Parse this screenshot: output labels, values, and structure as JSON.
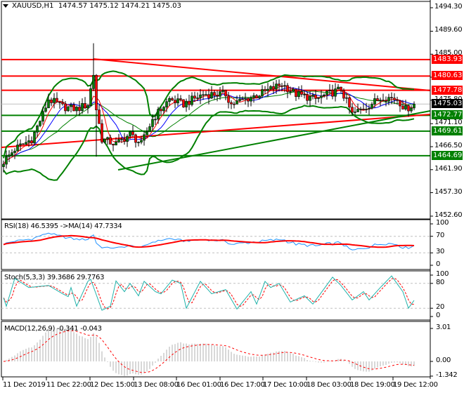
{
  "header": {
    "symbol": "XAUUSD,H1",
    "open": "1474.57",
    "high": "1475.12",
    "low": "1474.21",
    "close": "1475.03"
  },
  "price_axis": [
    "1494.30",
    "1489.60",
    "1485.00",
    "1480.40",
    "1475.80",
    "1471.10",
    "1466.50",
    "1461.90",
    "1457.30",
    "1452.60"
  ],
  "levels": [
    {
      "value": "1483.93",
      "color": "#ff0000"
    },
    {
      "value": "1480.63",
      "color": "#ff0000"
    },
    {
      "value": "1477.78",
      "color": "#ff0000"
    },
    {
      "value": "1475.03",
      "color": "#000000"
    },
    {
      "value": "1472.77",
      "color": "#008000"
    },
    {
      "value": "1469.61",
      "color": "#008000"
    },
    {
      "value": "1464.69",
      "color": "#008000"
    }
  ],
  "rsi": {
    "label": "RSI(18) 46.5395  ->MA(14) 47.7334",
    "axis": [
      "100",
      "70",
      "30",
      "0"
    ]
  },
  "stoch": {
    "label": "Stoch(5,3,3) 39.3686 29.7763",
    "axis": [
      "100",
      "80",
      "20",
      "0"
    ]
  },
  "macd": {
    "label": "MACD(12,26,9) -0.341 -0.043",
    "axis": [
      "3.01",
      "0.00",
      "-1.342"
    ]
  },
  "time_axis": [
    "11 Dec 2019",
    "11 Dec 22:00",
    "12 Dec 15:00",
    "13 Dec 08:00",
    "16 Dec 01:00",
    "16 Dec 17:00",
    "17 Dec 10:00",
    "18 Dec 03:00",
    "18 Dec 19:00",
    "19 Dec 12:00"
  ],
  "chart_data": {
    "type": "candlestick",
    "price_range": [
      1452.6,
      1494.3
    ],
    "close_keypoints": [
      [
        0,
        1463.5
      ],
      [
        4,
        1466
      ],
      [
        10,
        1468
      ],
      [
        14,
        1473
      ],
      [
        16,
        1476
      ],
      [
        21,
        1474.5
      ],
      [
        26,
        1474
      ],
      [
        30,
        1475
      ],
      [
        32,
        1481
      ],
      [
        33,
        1474
      ],
      [
        35,
        1468
      ],
      [
        40,
        1467
      ],
      [
        45,
        1469
      ],
      [
        49,
        1467
      ],
      [
        53,
        1472
      ],
      [
        59,
        1476
      ],
      [
        64,
        1475
      ],
      [
        71,
        1477
      ],
      [
        79,
        1477
      ],
      [
        81,
        1475
      ],
      [
        91,
        1477
      ],
      [
        99,
        1479
      ],
      [
        104,
        1477
      ],
      [
        111,
        1476
      ],
      [
        120,
        1478
      ],
      [
        124,
        1473
      ],
      [
        129,
        1474.5
      ],
      [
        135,
        1476.5
      ],
      [
        140,
        1476
      ],
      [
        143,
        1474
      ],
      [
        146,
        1475.03
      ]
    ],
    "stoch_keypoints": [
      [
        0,
        45
      ],
      [
        1,
        25
      ],
      [
        4,
        92
      ],
      [
        9,
        70
      ],
      [
        16,
        75
      ],
      [
        21,
        55
      ],
      [
        23,
        48
      ],
      [
        24,
        70
      ],
      [
        26,
        25
      ],
      [
        30,
        85
      ],
      [
        31,
        90
      ],
      [
        35,
        15
      ],
      [
        38,
        25
      ],
      [
        40,
        86
      ],
      [
        43,
        60
      ],
      [
        45,
        80
      ],
      [
        48,
        50
      ],
      [
        50,
        85
      ],
      [
        54,
        60
      ],
      [
        56,
        55
      ],
      [
        60,
        88
      ],
      [
        63,
        80
      ],
      [
        65,
        20
      ],
      [
        70,
        85
      ],
      [
        74,
        55
      ],
      [
        79,
        65
      ],
      [
        83,
        18
      ],
      [
        88,
        60
      ],
      [
        90,
        30
      ],
      [
        93,
        85
      ],
      [
        95,
        70
      ],
      [
        98,
        80
      ],
      [
        102,
        35
      ],
      [
        107,
        50
      ],
      [
        110,
        30
      ],
      [
        117,
        95
      ],
      [
        120,
        75
      ],
      [
        124,
        40
      ],
      [
        128,
        60
      ],
      [
        130,
        40
      ],
      [
        134,
        70
      ],
      [
        138,
        98
      ],
      [
        142,
        60
      ],
      [
        144,
        20
      ],
      [
        146,
        39
      ]
    ],
    "colors": {
      "bull": "#008000",
      "bear": "#ff0000",
      "bands": "#008000",
      "ma_fast": "#ff0000",
      "ma_slow": "#0000ff",
      "rsi": "#1e90ff",
      "stoch": "#20b2aa"
    }
  }
}
